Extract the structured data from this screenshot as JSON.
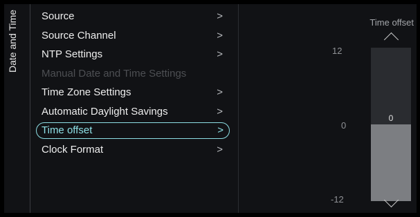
{
  "sidebar": {
    "title": "Date and Time"
  },
  "menu": {
    "items": [
      {
        "label": "Source",
        "state": "normal",
        "chevron": ">"
      },
      {
        "label": "Source Channel",
        "state": "normal",
        "chevron": ">"
      },
      {
        "label": "NTP Settings",
        "state": "normal",
        "chevron": ">"
      },
      {
        "label": "Manual Date and Time Settings",
        "state": "disabled",
        "chevron": ""
      },
      {
        "label": "Time Zone Settings",
        "state": "normal",
        "chevron": ">"
      },
      {
        "label": "Automatic Daylight Savings",
        "state": "normal",
        "chevron": ">"
      },
      {
        "label": "Time offset",
        "state": "selected",
        "chevron": ">"
      },
      {
        "label": "Clock Format",
        "state": "normal",
        "chevron": ">"
      }
    ]
  },
  "slider": {
    "title": "Time offset",
    "max_label": "12",
    "mid_label": "0",
    "min_label": "-12",
    "min": -12,
    "max": 12,
    "value": 0,
    "value_label": "0",
    "up_icon": "chevron-up-icon",
    "down_icon": "chevron-down-icon"
  },
  "colors": {
    "accent": "#8ee0e6",
    "background": "#111215",
    "disabled_text": "#4d4f53",
    "slider_fill": "#7c7e82",
    "slider_track": "#2a2c30"
  }
}
